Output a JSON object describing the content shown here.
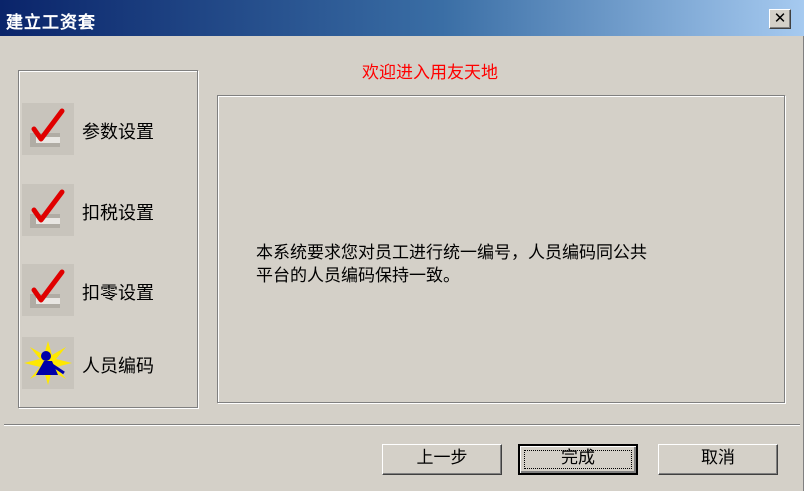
{
  "window": {
    "title": "建立工资套",
    "close_label": "✕"
  },
  "header": {
    "welcome": "欢迎进入用友天地"
  },
  "steps": [
    {
      "label": "参数设置",
      "icon": "checkmark-icon"
    },
    {
      "label": "扣税设置",
      "icon": "checkmark-icon"
    },
    {
      "label": "扣零设置",
      "icon": "checkmark-icon"
    },
    {
      "label": "人员编码",
      "icon": "person-burst-icon"
    }
  ],
  "content": {
    "line1": "本系统要求您对员工进行统一编号，人员编码同公共",
    "line2": "平台的人员编码保持一致。"
  },
  "buttons": {
    "prev": "上一步",
    "finish": "完成",
    "cancel": "取消"
  },
  "colors": {
    "welcome": "#ff0000",
    "title_bar": "#0a246a",
    "check": "#e00000"
  }
}
